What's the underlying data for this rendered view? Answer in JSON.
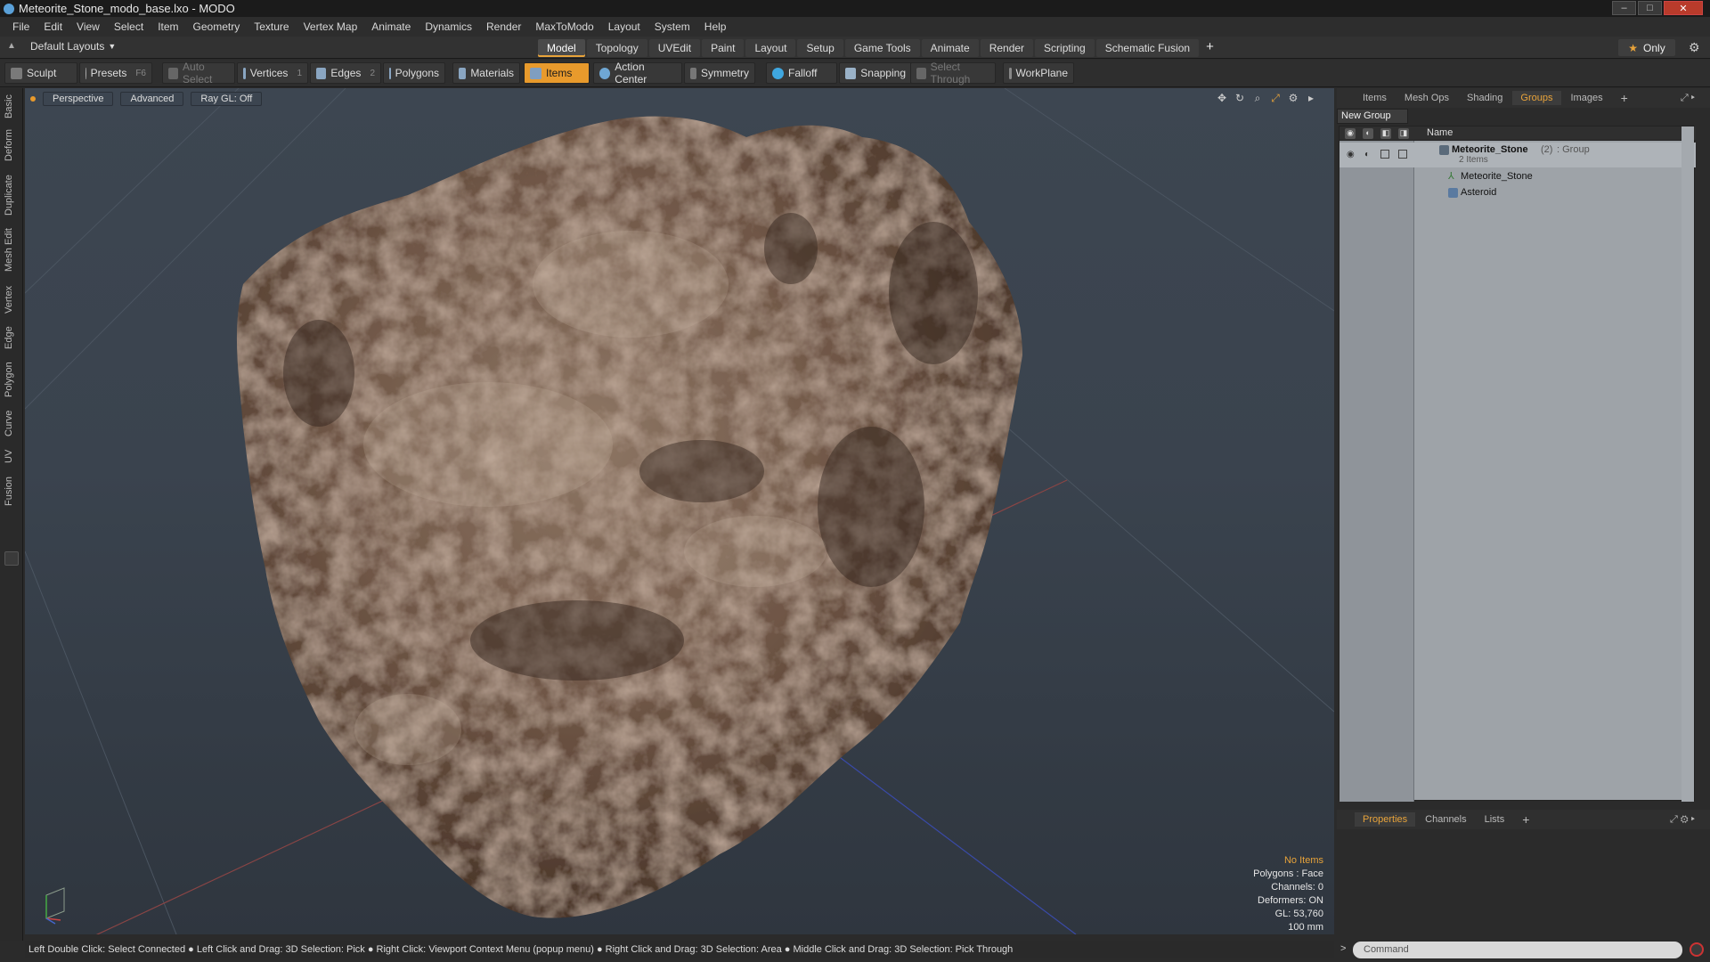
{
  "window": {
    "title": "Meteorite_Stone_modo_base.lxo - MODO"
  },
  "menu": [
    "File",
    "Edit",
    "View",
    "Select",
    "Item",
    "Geometry",
    "Texture",
    "Vertex Map",
    "Animate",
    "Dynamics",
    "Render",
    "MaxToModo",
    "Layout",
    "System",
    "Help"
  ],
  "layout_selector": "Default Layouts",
  "tabs": [
    "Model",
    "Topology",
    "UVEdit",
    "Paint",
    "Layout",
    "Setup",
    "Game Tools",
    "Animate",
    "Render",
    "Scripting",
    "Schematic Fusion"
  ],
  "active_tab": "Model",
  "only_label": "Only",
  "toolbar": {
    "sculpt": "Sculpt",
    "presets": "Presets",
    "presets_key": "F6",
    "auto_select": "Auto Select",
    "vertices": "Vertices",
    "vertices_key": "1",
    "edges": "Edges",
    "edges_key": "2",
    "polygons": "Polygons",
    "materials": "Materials",
    "items": "Items",
    "action_center": "Action Center",
    "symmetry": "Symmetry",
    "falloff": "Falloff",
    "snapping": "Snapping",
    "select_through": "Select Through",
    "workplane": "WorkPlane"
  },
  "left_tabs": [
    "Basic",
    "Deform",
    "Duplicate",
    "Mesh Edit",
    "Vertex",
    "Edge",
    "Polygon",
    "Curve",
    "UV",
    "Fusion"
  ],
  "viewport": {
    "perspective": "Perspective",
    "advanced": "Advanced",
    "raygl": "Ray GL: Off",
    "stats": {
      "items": "No Items",
      "polygons": "Polygons : Face",
      "channels": "Channels: 0",
      "deformers": "Deformers: ON",
      "gl": "GL: 53,760",
      "scale": "100 mm"
    }
  },
  "status_bar": "Left Double Click: Select Connected ● Left Click and Drag: 3D Selection: Pick ● Right Click: Viewport Context Menu (popup menu) ● Right Click and Drag: 3D Selection: Area ● Middle Click and Drag: 3D Selection: Pick Through",
  "right_panel": {
    "tabs": [
      "Items",
      "Mesh Ops",
      "Shading",
      "Groups",
      "Images"
    ],
    "active_tab": "Groups",
    "new_group": "New Group",
    "name_header": "Name",
    "group": {
      "name": "Meteorite_Stone",
      "count": "(2)",
      "type": ": Group",
      "subtitle": "2 Items"
    },
    "children": [
      "Meteorite_Stone",
      "Asteroid"
    ]
  },
  "bottom_panel": {
    "tabs": [
      "Properties",
      "Channels",
      "Lists"
    ],
    "active_tab": "Properties",
    "command_placeholder": "Command"
  },
  "colors": {
    "accent": "#e89a2c",
    "rock_base": "#7a6250"
  }
}
